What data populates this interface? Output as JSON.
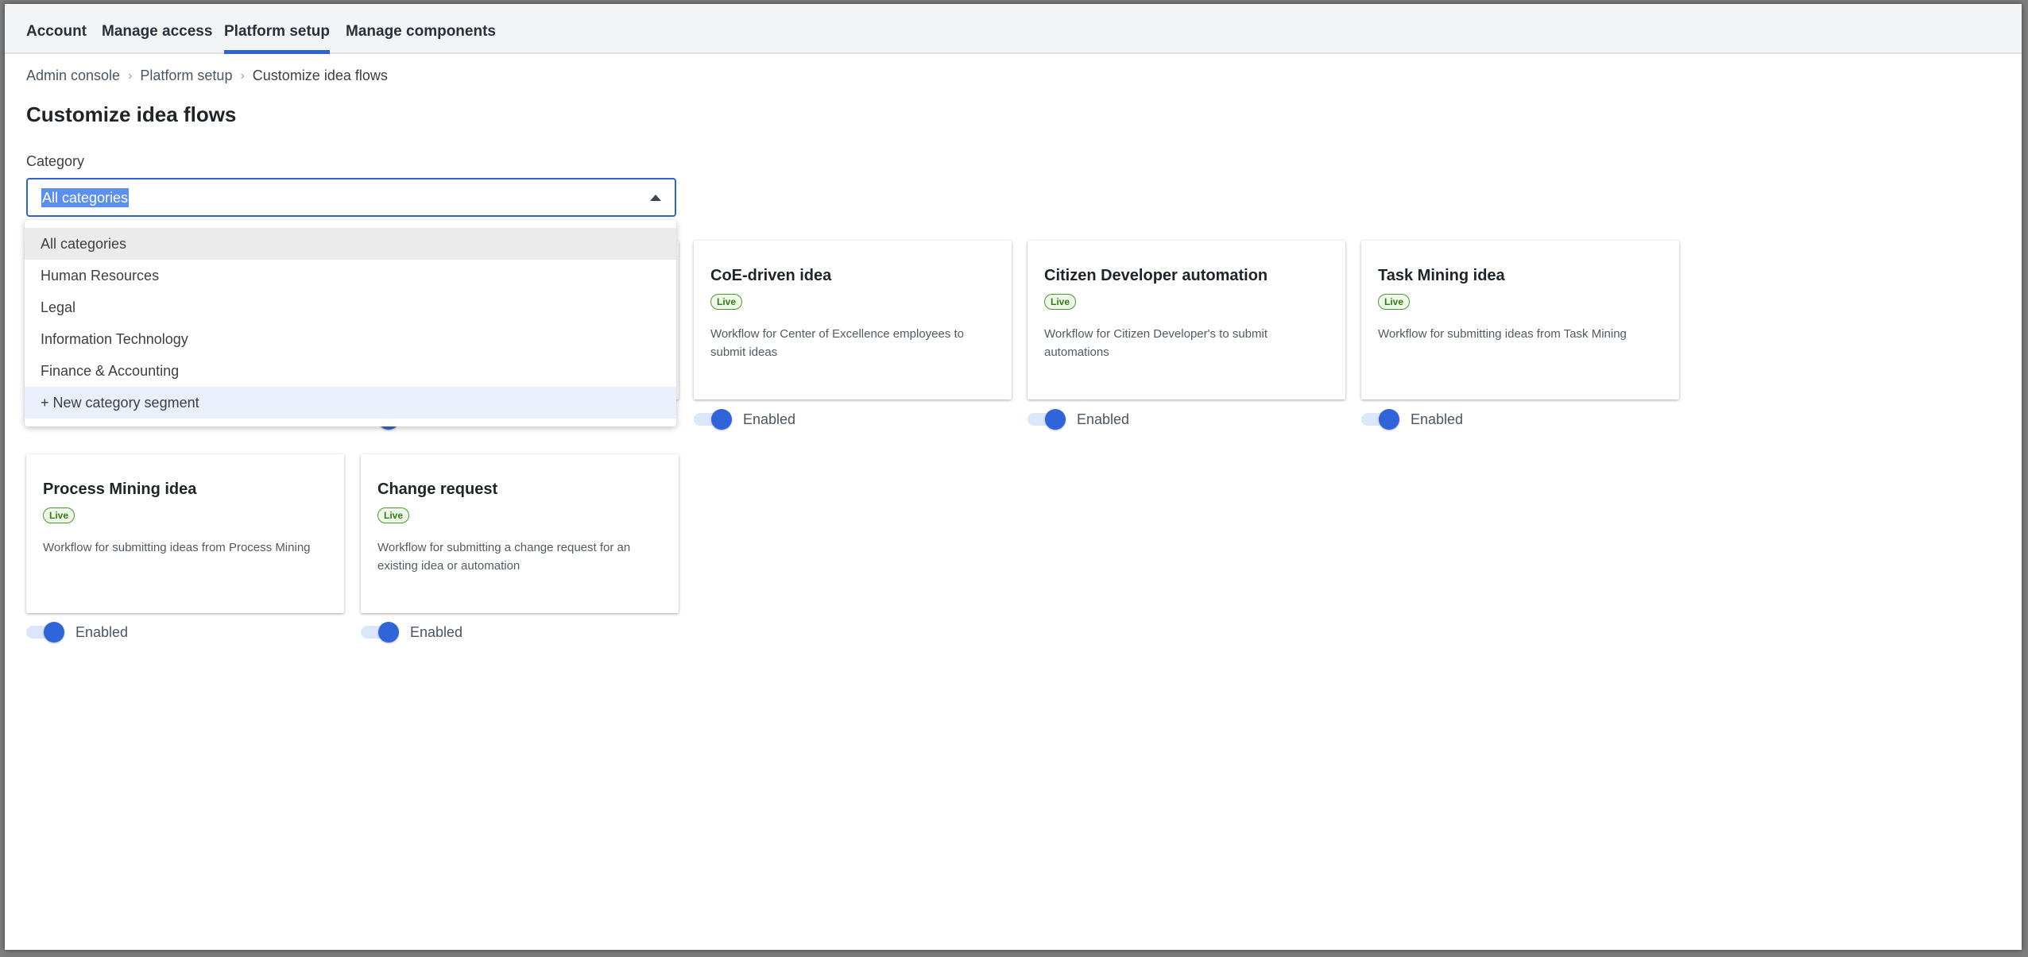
{
  "topnav": {
    "tabs": [
      {
        "label": "Account",
        "active": false
      },
      {
        "label": "Manage access",
        "active": false
      },
      {
        "label": "Platform setup",
        "active": true
      },
      {
        "label": "Manage components",
        "active": false
      }
    ]
  },
  "breadcrumb": {
    "items": [
      "Admin console",
      "Platform setup",
      "Customize idea flows"
    ],
    "separator": "›"
  },
  "page": {
    "title": "Customize idea flows"
  },
  "category": {
    "label": "Category",
    "selected": "All categories",
    "expanded": true,
    "options": [
      "All categories",
      "Human Resources",
      "Legal",
      "Information Technology",
      "Finance & Accounting"
    ],
    "new_option_label": "+ New category segment"
  },
  "colors": {
    "accent": "#2e64d6",
    "live_badge_text": "#2f7d12",
    "live_badge_border": "#4a9a2e",
    "toggle_track": "#dbe6fb"
  },
  "cards": [
    {
      "title": "",
      "badge": "",
      "description": "",
      "toggle_label": "",
      "enabled": true,
      "hidden": true
    },
    {
      "title": "",
      "badge": "",
      "description": "",
      "toggle_label": "",
      "enabled": true,
      "hidden": true
    },
    {
      "title": "CoE-driven idea",
      "badge": "Live",
      "description": "Workflow for Center of Excellence employees to submit ideas",
      "toggle_label": "Enabled",
      "enabled": true
    },
    {
      "title": "Citizen Developer automation",
      "badge": "Live",
      "description": "Workflow for Citizen Developer's to submit automations",
      "toggle_label": "Enabled",
      "enabled": true
    },
    {
      "title": "Task Mining idea",
      "badge": "Live",
      "description": "Workflow for submitting ideas from Task Mining",
      "toggle_label": "Enabled",
      "enabled": true
    },
    {
      "title": "Process Mining idea",
      "badge": "Live",
      "description": "Workflow for submitting ideas from Process Mining",
      "toggle_label": "Enabled",
      "enabled": true
    },
    {
      "title": "Change request",
      "badge": "Live",
      "description": "Workflow for submitting a change request for an existing idea or automation",
      "toggle_label": "Enabled",
      "enabled": true
    }
  ]
}
